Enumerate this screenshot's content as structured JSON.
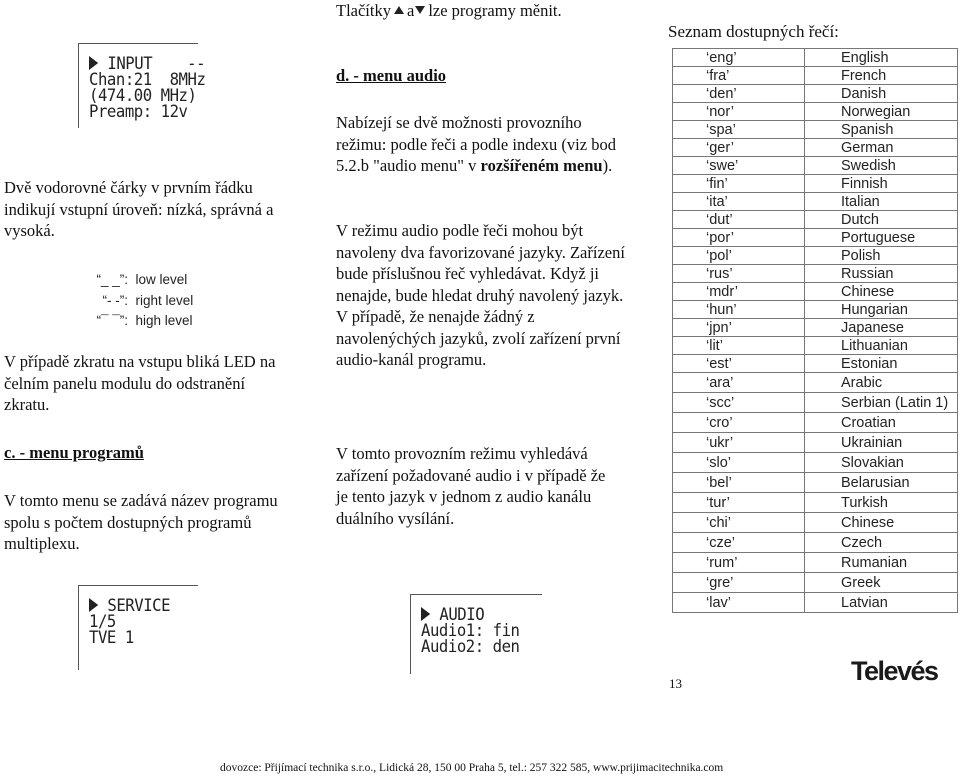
{
  "lcd_input": {
    "title": "INPUT",
    "level": "--",
    "line2": "Chan:21  8MHz",
    "line3": "(474.00 MHz)",
    "line4": "Preamp: 12v"
  },
  "left": {
    "para1": "Dvě vodorovné čárky v prvním řádku indikují vstupní úroveň: nízká, správná a vysoká.",
    "legend": [
      {
        "key": "“_ _”:",
        "label": "low level"
      },
      {
        "key": "“- -”:",
        "label": "right level"
      },
      {
        "key": "“¯ ¯”:",
        "label": "high level"
      }
    ],
    "para2": "V případě zkratu na vstupu bliká LED na čelním panelu modulu do odstranění zkratu.",
    "heading_c": "c. - menu programů",
    "para3": "V tomto menu se zadává název programu spolu s počtem dostupných programů multiplexu."
  },
  "lcd_service": {
    "title": "SERVICE",
    "line2": "1/5",
    "line3": "TVE 1"
  },
  "middle": {
    "buttons_text_pre": "Tlačítky",
    "buttons_text_mid": "a",
    "buttons_text_post": "lze programy měnit.",
    "heading_d": "d. - menu audio",
    "para1_a": "Nabízejí se dvě možnosti provozního režimu: podle řeči a podle indexu  (viz bod 5.2.b \"audio menu\" v ",
    "para1_bold": "rozšířeném menu",
    "para1_b": ").",
    "para2": "V režimu audio podle řeči mohou být navoleny dva favorizované jazyky. Zařízení bude příslušnou řeč vyhledávat. Když ji nenajde, bude hledat druhý navolený jazyk. V případě, že nenajde žádný z navolenýchých jazyků, zvolí zařízení první audio-kanál programu.",
    "para3": "V tomto provozním režimu vyhledává zařízení požadované audio i v případě že je tento jazyk v jednom z audio kanálu duálního vysílání."
  },
  "lcd_audio": {
    "title": "AUDIO",
    "line2": "Audio1: fin",
    "line3": "Audio2: den"
  },
  "languages": {
    "title": "Seznam dostupných řečí:",
    "rows": [
      {
        "code": "‘eng’",
        "name": "English"
      },
      {
        "code": "‘fra’",
        "name": "French"
      },
      {
        "code": "‘den’",
        "name": "Danish"
      },
      {
        "code": "‘nor’",
        "name": "Norwegian"
      },
      {
        "code": "‘spa’",
        "name": "Spanish"
      },
      {
        "code": "‘ger’",
        "name": "German"
      },
      {
        "code": "‘swe’",
        "name": "Swedish"
      },
      {
        "code": "‘fin’",
        "name": "Finnish"
      },
      {
        "code": "‘ita’",
        "name": "Italian"
      },
      {
        "code": "‘dut’",
        "name": "Dutch"
      },
      {
        "code": "‘por’",
        "name": "Portuguese"
      },
      {
        "code": "‘pol’",
        "name": "Polish"
      },
      {
        "code": "‘rus’",
        "name": "Russian"
      },
      {
        "code": "‘mdr’",
        "name": "Chinese"
      },
      {
        "code": "‘hun’",
        "name": "Hungarian"
      },
      {
        "code": "‘jpn’",
        "name": "Japanese"
      },
      {
        "code": "‘lit’",
        "name": "Lithuanian"
      },
      {
        "code": "‘est’",
        "name": "Estonian"
      },
      {
        "code": "‘ara’",
        "name": "Arabic"
      },
      {
        "code": "‘scc’",
        "name": "Serbian (Latin 1)"
      },
      {
        "code": "‘cro’",
        "name": "Croatian"
      },
      {
        "code": "‘ukr’",
        "name": "Ukrainian"
      },
      {
        "code": "‘slo’",
        "name": "Slovakian"
      },
      {
        "code": "‘bel’",
        "name": "Belarusian"
      },
      {
        "code": "‘tur’",
        "name": "Turkish"
      },
      {
        "code": "‘chi’",
        "name": "Chinese"
      },
      {
        "code": "‘cze’",
        "name": "Czech"
      },
      {
        "code": "‘rum’",
        "name": "Rumanian"
      },
      {
        "code": "‘gre’",
        "name": "Greek"
      },
      {
        "code": "‘lav’",
        "name": "Latvian"
      }
    ]
  },
  "page_number": "13",
  "brand": "Televés",
  "footer": "dovozce: Přijímací technika s.r.o., Lidická 28, 150 00 Praha 5, tel.: 257 322 585, www.prijimacitechnika.com"
}
